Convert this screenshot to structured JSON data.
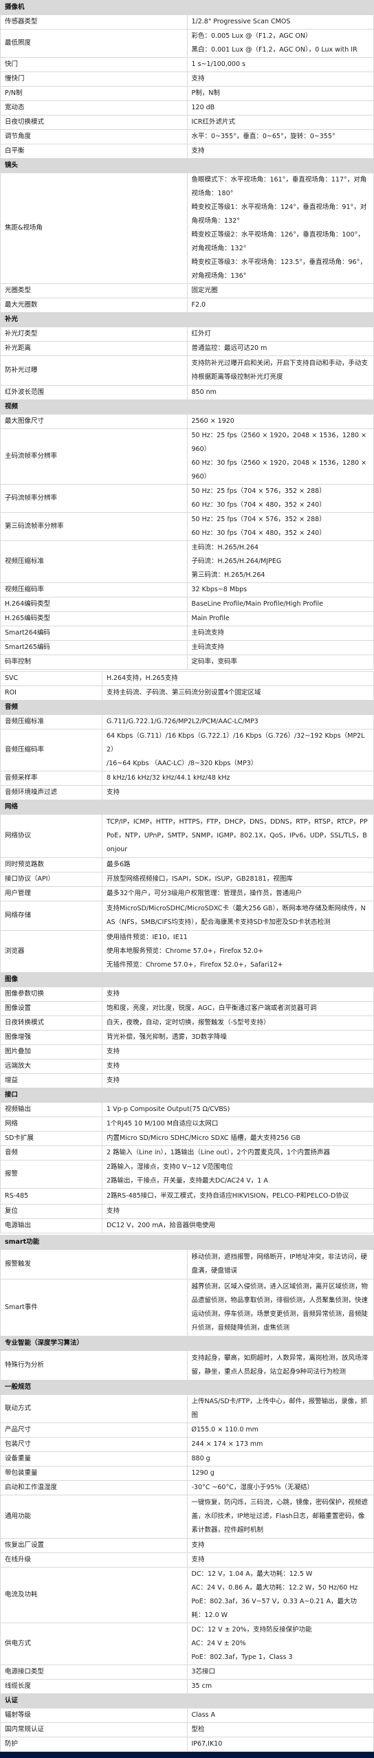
{
  "sections_a": [
    {
      "title": "摄像机",
      "rows": [
        {
          "label": "传感器类型",
          "lines": [
            "1/2.8\" Progressive Scan CMOS"
          ]
        },
        {
          "label": "最低照度",
          "lines": [
            "彩色：0.005 Lux @（F1.2，AGC ON）",
            "黑白：0.001 Lux @（F1.2，AGC ON），0 Lux with IR"
          ]
        },
        {
          "label": "快门",
          "lines": [
            "1 s~1/100,000 s"
          ]
        },
        {
          "label": "慢快门",
          "lines": [
            "支持"
          ]
        },
        {
          "label": "P/N制",
          "lines": [
            "P制，N制"
          ]
        },
        {
          "label": "宽动态",
          "lines": [
            "120 dB"
          ]
        },
        {
          "label": "日夜切换模式",
          "lines": [
            "ICR红外滤片式"
          ]
        },
        {
          "label": "调节角度",
          "lines": [
            "水平：0~355°，垂直：0~65°，旋转：0~355°"
          ]
        },
        {
          "label": "白平衡",
          "lines": [
            "支持"
          ]
        }
      ]
    },
    {
      "title": "镜头",
      "rows": [
        {
          "label": "焦距&视场角",
          "lines": [
            "鱼眼模式下：水平视场角：161°，垂直视场角：117°，对角视场角：180°",
            "畸变校正等级1：水平视场角：124°，垂直视场角：91°，对角视场角：132°",
            "畸变校正等级2：水平视场角：126°，垂直视场角：100°，对角视场角：132°",
            "畸变校正等级3：水平视场角：123.5°，垂直视场角：96°，对角视场角：136°"
          ]
        },
        {
          "label": "光圈类型",
          "lines": [
            "固定光圈"
          ]
        },
        {
          "label": "最大光圈数",
          "lines": [
            "F2.0"
          ]
        }
      ]
    },
    {
      "title": "补光",
      "rows": [
        {
          "label": "补光灯类型",
          "lines": [
            "红外灯"
          ]
        },
        {
          "label": "补光距离",
          "lines": [
            "普通监控：最远可达20 m"
          ]
        },
        {
          "label": "防补光过曝",
          "text": "支持防补光过曝开启和关闭，开启下支持自动和手动，手动支持根据距离等级控制补光灯亮度"
        },
        {
          "label": "红外波长范围",
          "lines": [
            "850 nm"
          ]
        }
      ]
    },
    {
      "title": "视频",
      "rows": [
        {
          "label": "最大图像尺寸",
          "lines": [
            "2560 × 1920"
          ]
        },
        {
          "label": "主码流帧率分辨率",
          "lines": [
            "50 Hz：25 fps（2560 × 1920，2048 × 1536，1280 × 960）",
            "60 Hz：30 fps（2560 × 1920，2048 × 1536，1280 × 960）"
          ]
        },
        {
          "label": "子码流帧率分辨率",
          "lines": [
            "50 Hz：25 fps（704 × 576，352 × 288）",
            "60 Hz：30 fps（704 × 480，352 × 240）"
          ]
        },
        {
          "label": "第三码流帧率分辨率",
          "lines": [
            "50 Hz：25 fps（704 × 576，352 × 288）",
            "60 Hz：30 fps（704 × 480，352 × 240）"
          ]
        },
        {
          "label": "视频压缩标准",
          "lines": [
            "主码流：H.265/H.264",
            "子码流：H.265/H.264/MJPEG",
            "第三码流：H.265/H.264"
          ]
        },
        {
          "label": "视频压缩码率",
          "lines": [
            "32 Kbps~8 Mbps"
          ]
        },
        {
          "label": "H.264编码类型",
          "lines": [
            "BaseLine Profile/Main Profile/High Profile"
          ]
        },
        {
          "label": "H.265编码类型",
          "lines": [
            "Main Profile"
          ]
        },
        {
          "label": "Smart264编码",
          "lines": [
            "主码流支持"
          ]
        },
        {
          "label": "Smart265编码",
          "lines": [
            "主码流支持"
          ]
        },
        {
          "label": "码率控制",
          "lines": [
            "定码率，变码率"
          ]
        }
      ]
    }
  ],
  "sections_b": [
    {
      "title": "",
      "rows": [
        {
          "label": "SVC",
          "lines": [
            "H.264支持，H.265支持"
          ]
        },
        {
          "label": "ROI",
          "lines": [
            "支持主码流、子码流、第三码流分别设置4个固定区域"
          ]
        }
      ]
    },
    {
      "title": "音频",
      "rows": [
        {
          "label": "音频压缩标准",
          "lines": [
            "G.711/G.722.1/G.726/MP2L2/PCM/AAC-LC/MP3"
          ]
        },
        {
          "label": "音频压缩码率",
          "lines": [
            "64 Kbps（G.711）/16 Kbps（G.722.1）/16 Kbps（G.726）/32~192 Kbps（MP2L2）",
            "/16~64 Kpbs （AAC-LC）/8~320 Kbps（MP3）"
          ]
        },
        {
          "label": "音频采样率",
          "lines": [
            "8 kHz/16 kHz/32 kHz/44.1 kHz/48 kHz"
          ]
        },
        {
          "label": "音频环境噪声过滤",
          "lines": [
            "支持"
          ]
        }
      ]
    },
    {
      "title": "网络",
      "rows": [
        {
          "label": "网络协议",
          "text": "TCP/IP，ICMP，HTTP，HTTPS，FTP，DHCP，DNS，DDNS，RTP，RTSP，RTCP，PPPoE，NTP，UPnP，SMTP，SNMP，IGMP，802.1X，QoS，IPv6，UDP，SSL/TLS，Bonjour"
        },
        {
          "label": "同时预览路数",
          "lines": [
            "最多6路"
          ]
        },
        {
          "label": "接口协议（API）",
          "lines": [
            "开放型网络视频接口，ISAPI，SDK，ISUP，GB28181，视图库"
          ]
        },
        {
          "label": "用户管理",
          "lines": [
            "最多32个用户，可分3级用户权限管理：管理员，操作员，普通用户"
          ]
        },
        {
          "label": "网络存储",
          "text": "支持MicroSD/MicroSDHC/MicroSDXC卡（最大256 GB），断网本地存储及断网续传，NAS（NFS，SMB/CIFS均支持），配合海康黑卡支持SD卡加密及SD卡状态检测"
        },
        {
          "label": "浏览器",
          "lines": [
            "使用插件预览：IE10，IE11",
            "使用本地服务预览：Chrome 57.0+，Firefox 52.0+",
            "无插件预览：Chrome 57.0+，Firefox 52.0+，Safari12+"
          ]
        }
      ]
    },
    {
      "title": "图像",
      "rows": [
        {
          "label": "图像参数切换",
          "lines": [
            "支持"
          ]
        },
        {
          "label": "图像设置",
          "lines": [
            "饱和度，亮度，对比度，锐度，AGC，白平衡通过客户端或者浏览器可调"
          ]
        },
        {
          "label": "日夜转换模式",
          "lines": [
            "白天，夜晚，自动，定时切换，报警触发（-S型号支持）"
          ]
        },
        {
          "label": "图像增强",
          "lines": [
            "背光补偿，强光抑制，透雾，3D数字降噪"
          ]
        },
        {
          "label": "图片叠加",
          "lines": [
            "支持"
          ]
        },
        {
          "label": "远端放大",
          "lines": [
            "支持"
          ]
        },
        {
          "label": "增益",
          "lines": [
            "支持"
          ]
        }
      ]
    },
    {
      "title": "接口",
      "rows": [
        {
          "label": "视频输出",
          "lines": [
            "1 Vp-p Composite Output(75 Ω/CVBS)"
          ]
        },
        {
          "label": "网络",
          "lines": [
            "1个RJ45 10 M/100 M自适应以太网口"
          ]
        },
        {
          "label": "SD卡扩展",
          "lines": [
            "内置Micro SD/Micro SDHC/Micro SDXC 插槽，最大支持256 GB"
          ]
        },
        {
          "label": "音频",
          "lines": [
            "2 路输入（Line in），1路输出（Line out），2个内置麦克风，1个内置扬声器"
          ]
        },
        {
          "label": "报警",
          "lines": [
            "2路输入，湿接点，支持0 V~12 V范围电位",
            "2路输出，干接点，开关量，支持最大DC/AC24 V，1 A"
          ]
        },
        {
          "label": "RS-485",
          "text": "2路RS-485接口，半双工模式，支持自适应HIKVISION，PELCO-P和PELCO-D协议"
        },
        {
          "label": "复位",
          "lines": [
            "支持"
          ]
        },
        {
          "label": "电源输出",
          "lines": [
            "DC12 V，200 mA，拾音器供电使用"
          ]
        }
      ]
    }
  ],
  "sections_c": [
    {
      "title": "smart功能",
      "rows": [
        {
          "label": "报警触发",
          "text": "移动侦测，遮挡报警，网络断开，IP地址冲突，非法访问，硬盘满，硬盘错误"
        },
        {
          "label": "Smart事件",
          "text": "越界侦测，区域入侵侦测，进入区域侦测，离开区域侦测，物品遗留侦测，物品拿取侦测，徘徊侦测，人员聚集侦测，快速运动侦测，停车侦测，场景变更侦测，音频异常侦测，音频陡升侦测，音频陡降侦测，虚焦侦测"
        }
      ]
    },
    {
      "title": "专业智能（深度学习算法）",
      "rows": [
        {
          "label": "特殊行为分析",
          "text": "支持起身，攀高，如厕超时，人数异常，离岗检测，放风场滞留，静坐，重点人员起身，站立起身9种司法行为检测"
        }
      ]
    },
    {
      "title": "一般规范",
      "rows": [
        {
          "label": "联动方式",
          "lines": [
            "上传NAS/SD卡/FTP，上传中心，邮件，报警输出，录像，抓图"
          ]
        },
        {
          "label": "产品尺寸",
          "lines": [
            "Ø155.0 × 110.0 mm"
          ]
        },
        {
          "label": "包装尺寸",
          "lines": [
            "244 × 174 × 173 mm"
          ]
        },
        {
          "label": "设备重量",
          "lines": [
            "880 g"
          ]
        },
        {
          "label": "带包装重量",
          "lines": [
            "1290 g"
          ]
        },
        {
          "label": "启动和工作温湿度",
          "lines": [
            "-30°C ~60°C，湿度小于95%（无凝结）"
          ]
        },
        {
          "label": "通用功能",
          "text": "一键恢复，防闪烁，三码流，心跳，镜像，密码保护，视频遮盖，水印技术，IP地址过滤，Flash日志，邮箱重置密码，像素计数器，控件超时机制"
        },
        {
          "label": "恢复出厂设置",
          "lines": [
            "支持"
          ]
        },
        {
          "label": "在线升级",
          "lines": [
            "支持"
          ]
        },
        {
          "label": "电流及功耗",
          "lines": [
            "DC：12 V，1.04 A，最大功耗：12.5 W",
            "AC：24 V，0.86 A，最大功耗：12.2 W，50 Hz/60 Hz",
            "PoE：802.3af，36 V~57 V，0.33 A~0.21 A，最大功耗：12.0 W"
          ]
        },
        {
          "label": "供电方式",
          "lines": [
            "DC：12 V ± 20%，支持防反接保护功能",
            "AC：24 V ± 20%",
            "PoE：802.3af，Type 1，Class 3"
          ]
        },
        {
          "label": "电源接口类型",
          "lines": [
            "3芯接口"
          ]
        },
        {
          "label": "线缆长度",
          "lines": [
            "35 cm"
          ]
        }
      ]
    },
    {
      "title": "认证",
      "rows": [
        {
          "label": "辐射等级",
          "lines": [
            "Class A"
          ]
        },
        {
          "label": "国内常规认证",
          "lines": [
            "型检"
          ]
        },
        {
          "label": "防护",
          "lines": [
            "IP67,IK10"
          ]
        }
      ]
    }
  ],
  "colors": {
    "section_header_bg": "#d9d9d9",
    "border": "#d9d9d9",
    "footer_bar": "#001540"
  }
}
